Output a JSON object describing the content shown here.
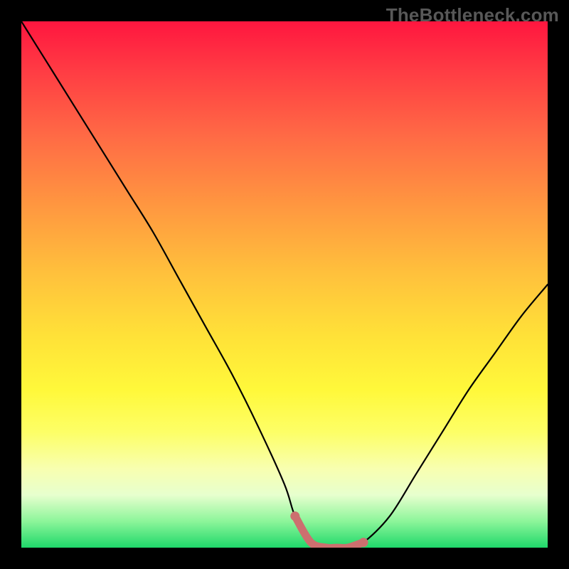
{
  "watermark": "TheBottleneck.com",
  "chart_data": {
    "type": "line",
    "title": "",
    "xlabel": "",
    "ylabel": "",
    "xlim": [
      0,
      100
    ],
    "ylim": [
      0,
      100
    ],
    "grid": false,
    "legend": false,
    "series": [
      {
        "name": "curve",
        "x": [
          0,
          5,
          10,
          15,
          20,
          25,
          30,
          35,
          40,
          45,
          50,
          52,
          55,
          58,
          60,
          62,
          65,
          70,
          75,
          80,
          85,
          90,
          95,
          100
        ],
        "values": [
          100,
          92,
          84,
          76,
          68,
          60,
          51,
          42,
          33,
          23,
          12,
          6,
          1,
          0,
          0,
          0,
          1,
          6,
          14,
          22,
          30,
          37,
          44,
          50
        ]
      }
    ],
    "flat_region": {
      "x_start": 52,
      "x_end": 65,
      "marker_color": "#cc6f6f"
    },
    "background_gradient": {
      "orientation": "vertical",
      "stops": [
        {
          "pos": 0.0,
          "color": "#ff163f"
        },
        {
          "pos": 0.35,
          "color": "#ff9740"
        },
        {
          "pos": 0.6,
          "color": "#ffe238"
        },
        {
          "pos": 0.85,
          "color": "#f8ffb0"
        },
        {
          "pos": 1.0,
          "color": "#1fd86a"
        }
      ]
    }
  }
}
